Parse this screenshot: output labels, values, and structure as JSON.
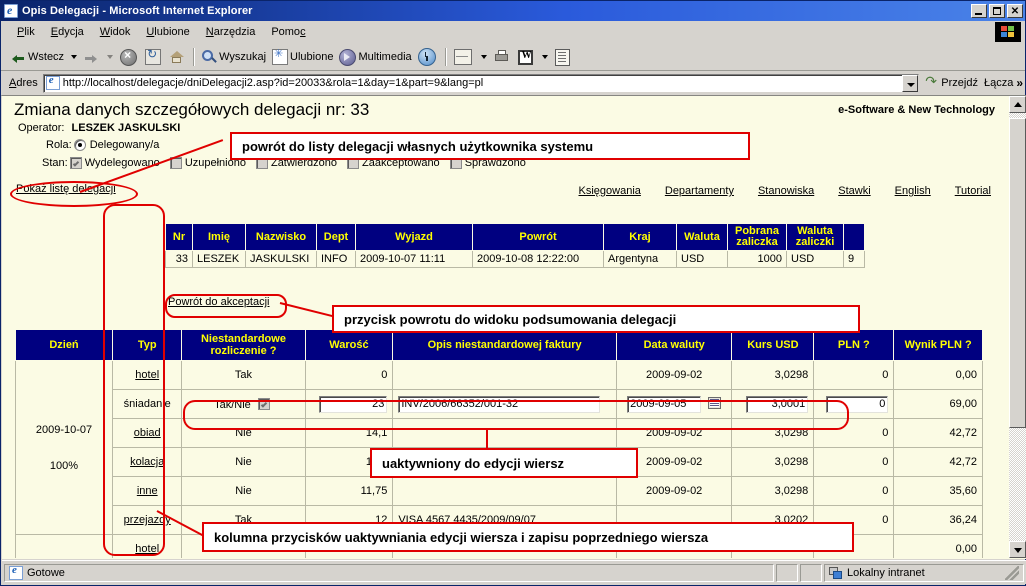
{
  "window": {
    "title": "Opis Delegacji - Microsoft Internet Explorer",
    "minimize_label": "_",
    "maximize_label": "□",
    "close_label": "✕"
  },
  "menu": {
    "items": [
      {
        "label": "Plik",
        "mnemonic": "P"
      },
      {
        "label": "Edycja",
        "mnemonic": "E"
      },
      {
        "label": "Widok",
        "mnemonic": "W"
      },
      {
        "label": "Ulubione",
        "mnemonic": "U"
      },
      {
        "label": "Narzędzia",
        "mnemonic": "N"
      },
      {
        "label": "Pomoc",
        "mnemonic": "c"
      }
    ]
  },
  "toolbar": {
    "back_label": "Wstecz",
    "forward_label": "",
    "stop_label": "",
    "refresh_label": "",
    "home_label": "",
    "search_label": "Wyszukaj",
    "favorites_label": "Ulubione",
    "media_label": "Multimedia",
    "history_label": "",
    "mail_label": "",
    "print_label": "",
    "edit_word_label": "",
    "discuss_label": ""
  },
  "address_bar": {
    "label": "Adres",
    "url": "http://localhost/delegacje/dniDelegacji2.asp?id=20033&rola=1&day=1&part=9&lang=pl",
    "go_label": "Przejdź",
    "links_label": "Łącza",
    "chevron": "»"
  },
  "page": {
    "heading": "Zmiana danych szczegółowych delegacji nr: 33",
    "brand": "e-Software & New Technology",
    "operator_label": "Operator:",
    "operator_value": "LESZEK JASKULSKI",
    "rola_label": "Rola:",
    "rola_option": "Delegowany/a",
    "stan_label": "Stan:",
    "stan_checkboxes": [
      {
        "label": "Wydelegowano",
        "checked": true
      },
      {
        "label": "Uzupełniono",
        "checked": false
      },
      {
        "label": "Zatwierdzono",
        "checked": false
      },
      {
        "label": "Zaakceptowano",
        "checked": false
      },
      {
        "label": "Sprawdzono",
        "checked": false
      }
    ],
    "show_list_link": "Pokaż listę delegacji",
    "nav_links": [
      "Księgowania",
      "Departamenty",
      "Stanowiska",
      "Stawki",
      "English",
      "Tutorial"
    ],
    "return_link": "Powrót do akceptacji"
  },
  "summary_table": {
    "headers": [
      "Nr",
      "Imię",
      "Nazwisko",
      "Dept",
      "Wyjazd",
      "Powrót",
      "Kraj",
      "Waluta",
      "Pobrana zaliczka",
      "Waluta zaliczki",
      ""
    ],
    "headers_multiline": [
      {
        "l1": "Nr",
        "l2": ""
      },
      {
        "l1": "Imię",
        "l2": ""
      },
      {
        "l1": "Nazwisko",
        "l2": ""
      },
      {
        "l1": "Dept",
        "l2": ""
      },
      {
        "l1": "Wyjazd",
        "l2": ""
      },
      {
        "l1": "Powrót",
        "l2": ""
      },
      {
        "l1": "Kraj",
        "l2": ""
      },
      {
        "l1": "Waluta",
        "l2": ""
      },
      {
        "l1": "Pobrana",
        "l2": "zaliczka"
      },
      {
        "l1": "Waluta",
        "l2": "zaliczki"
      },
      {
        "l1": "",
        "l2": ""
      }
    ],
    "row": {
      "nr": "33",
      "imie": "LESZEK",
      "nazwisko": "JASKULSKI",
      "dept": "INFO",
      "wyjazd": "2009-10-07 11:11",
      "powrot": "2009-10-08 12:22:00",
      "kraj": "Argentyna",
      "waluta": "USD",
      "zaliczka": "1000",
      "waluta_zaliczki": "USD",
      "last": "9"
    }
  },
  "grid": {
    "headers": [
      {
        "l1": "Dzień",
        "l2": ""
      },
      {
        "l1": "Typ",
        "l2": ""
      },
      {
        "l1": "Niestandardowe",
        "l2": "rozliczenie ?"
      },
      {
        "l1": "Warość",
        "l2": ""
      },
      {
        "l1": "Opis niestandardowej faktury",
        "l2": ""
      },
      {
        "l1": "Data waluty",
        "l2": ""
      },
      {
        "l1": "Kurs USD",
        "l2": ""
      },
      {
        "l1": "PLN ?",
        "l2": ""
      },
      {
        "l1": "Wynik PLN ?",
        "l2": ""
      }
    ],
    "day_cell": {
      "date": "2009-10-07",
      "percent": "100%"
    },
    "rows": [
      {
        "typ": "hotel",
        "nonstd": "Tak",
        "wartosc": "0",
        "opis": "",
        "data_waluty": "2009-09-02",
        "kurs": "3,0298",
        "pln": "0",
        "wynik": "0,00",
        "editing": false
      },
      {
        "typ": "śniadanie",
        "nonstd": "Tak/Nie",
        "wartosc": "23",
        "opis": "INV/2006/66352/001-32",
        "data_waluty": "2009-09-05",
        "kurs": "3,0001",
        "pln": "0",
        "wynik": "69,00",
        "editing": true,
        "nonstd_checked": true
      },
      {
        "typ": "obiad",
        "nonstd": "Nie",
        "wartosc": "14,1",
        "opis": "",
        "data_waluty": "2009-09-02",
        "kurs": "3,0298",
        "pln": "0",
        "wynik": "42,72",
        "editing": false
      },
      {
        "typ": "kolacja",
        "nonstd": "Nie",
        "wartosc": "14,1",
        "opis": "",
        "data_waluty": "2009-09-02",
        "kurs": "3,0298",
        "pln": "0",
        "wynik": "42,72",
        "editing": false
      },
      {
        "typ": "inne",
        "nonstd": "Nie",
        "wartosc": "11,75",
        "opis": "",
        "data_waluty": "2009-09-02",
        "kurs": "3,0298",
        "pln": "0",
        "wynik": "35,60",
        "editing": false
      },
      {
        "typ": "przejazdy",
        "nonstd": "Tak",
        "wartosc": "12",
        "opis": "VISA 4567    4435/2009/09/07",
        "data_waluty": "",
        "kurs": "3,0202",
        "pln": "0",
        "wynik": "36,24",
        "editing": false
      },
      {
        "typ": "hotel",
        "nonstd": "",
        "wartosc": "",
        "opis": "",
        "data_waluty": "",
        "kurs": "",
        "pln": "",
        "wynik": "0,00",
        "editing": false
      }
    ]
  },
  "annotations": [
    {
      "id": "a1",
      "text": "powrót do listy delegacji własnych użytkownika systemu"
    },
    {
      "id": "a2",
      "text": "przycisk powrotu do widoku podsumowania delegacji"
    },
    {
      "id": "a3",
      "text": "uaktywniony do edycji wiersz"
    },
    {
      "id": "a4",
      "text": "kolumna przycisków uaktywniania edycji wiersza i zapisu poprzedniego wiersza"
    }
  ],
  "status_bar": {
    "status_text": "Gotowe",
    "zone_text": "Lokalny intranet"
  },
  "colors": {
    "titlebar_start": "#0a246a",
    "titlebar_end": "#4a83e8",
    "chrome": "#d6d3ce",
    "page_bg": "#fbfbe4",
    "table_header_bg": "#000080",
    "table_header_fg": "#ffff00",
    "annotation_red": "#e00000"
  }
}
